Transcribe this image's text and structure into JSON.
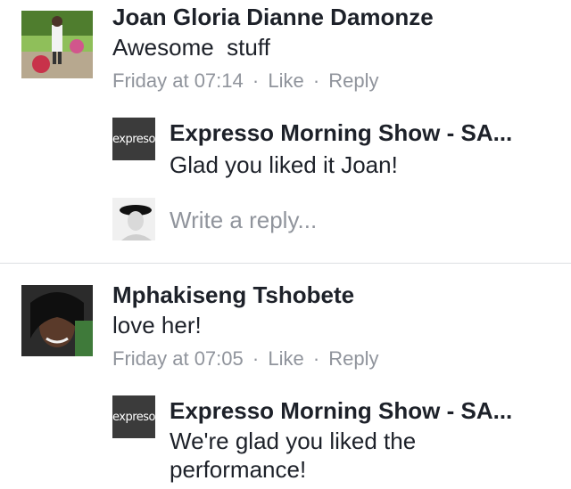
{
  "comments": [
    {
      "author": "Joan Gloria Dianne Damonze",
      "text": "Awesome  stuff",
      "time": "Friday at 07:14",
      "sep1": "·",
      "like": "Like",
      "sep2": "·",
      "reply": "Reply",
      "replies": [
        {
          "author": "Expresso Morning Show - SA...",
          "text": "Glad you liked it Joan!",
          "avatar_text": "expreso"
        }
      ],
      "reply_input": {
        "placeholder": "Write a reply..."
      }
    },
    {
      "author": "Mphakiseng Tshobete",
      "text": "love her!",
      "time": "Friday at 07:05",
      "sep1": "·",
      "like": "Like",
      "sep2": "·",
      "reply": "Reply",
      "replies": [
        {
          "author": "Expresso Morning Show - SA...",
          "text_line1": "We're glad you liked the",
          "text_line2": "performance!",
          "avatar_text": "expreso"
        }
      ]
    }
  ],
  "colors": {
    "meta": "#90949c",
    "text": "#1d2129",
    "divider": "#dddfe2",
    "logo_bg": "#3b3b3b"
  }
}
